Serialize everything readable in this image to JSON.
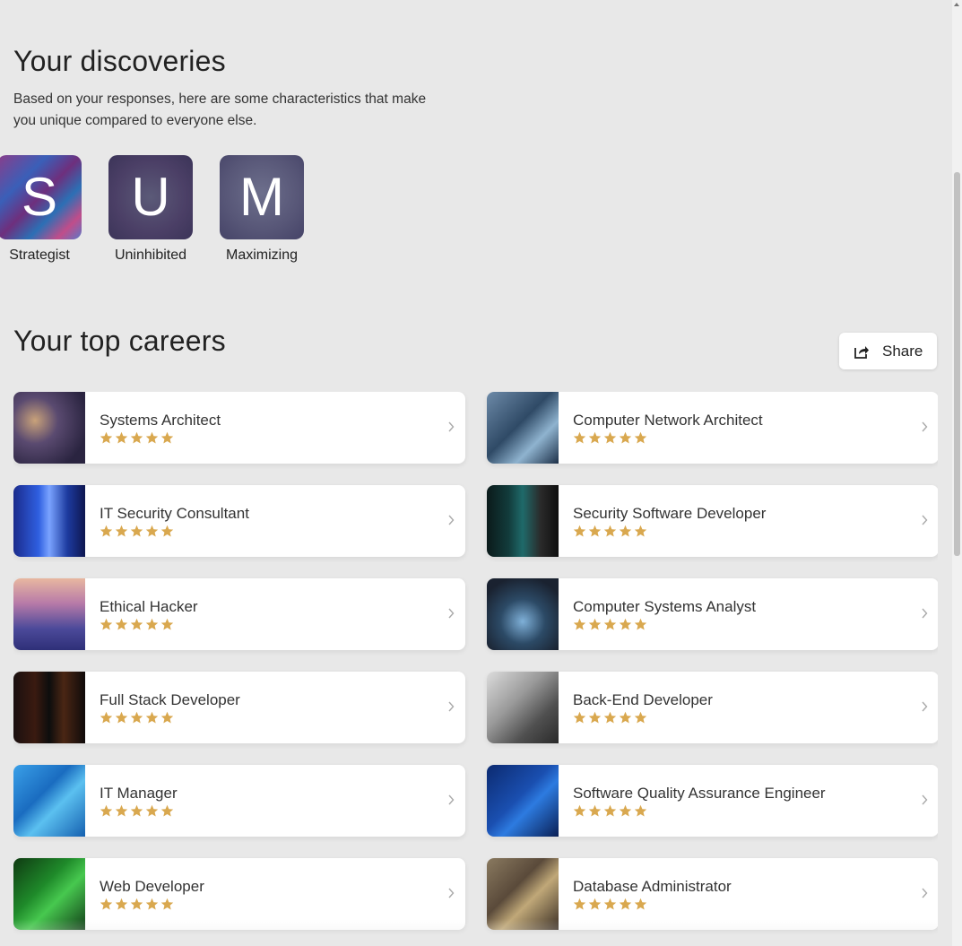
{
  "discoveries": {
    "title": "Your discoveries",
    "description": "Based on your responses, here are some characteristics that make you unique compared to everyone else.",
    "traits": [
      {
        "letter": "S",
        "label": "Strategist"
      },
      {
        "letter": "U",
        "label": "Uninhibited"
      },
      {
        "letter": "M",
        "label": "Maximizing"
      }
    ]
  },
  "careers": {
    "title": "Your top careers",
    "share_label": "Share",
    "star_color": "#d9a84f",
    "items": [
      {
        "title": "Systems Architect",
        "rating": 5
      },
      {
        "title": "Computer Network Architect",
        "rating": 5
      },
      {
        "title": "IT Security Consultant",
        "rating": 5
      },
      {
        "title": "Security Software Developer",
        "rating": 5
      },
      {
        "title": "Ethical Hacker",
        "rating": 5
      },
      {
        "title": "Computer Systems Analyst",
        "rating": 5
      },
      {
        "title": "Full Stack Developer",
        "rating": 5
      },
      {
        "title": "Back-End Developer",
        "rating": 5
      },
      {
        "title": "IT Manager",
        "rating": 5
      },
      {
        "title": "Software Quality Assurance Engineer",
        "rating": 5
      },
      {
        "title": "Web Developer",
        "rating": 5
      },
      {
        "title": "Database Administrator",
        "rating": 5
      }
    ]
  }
}
